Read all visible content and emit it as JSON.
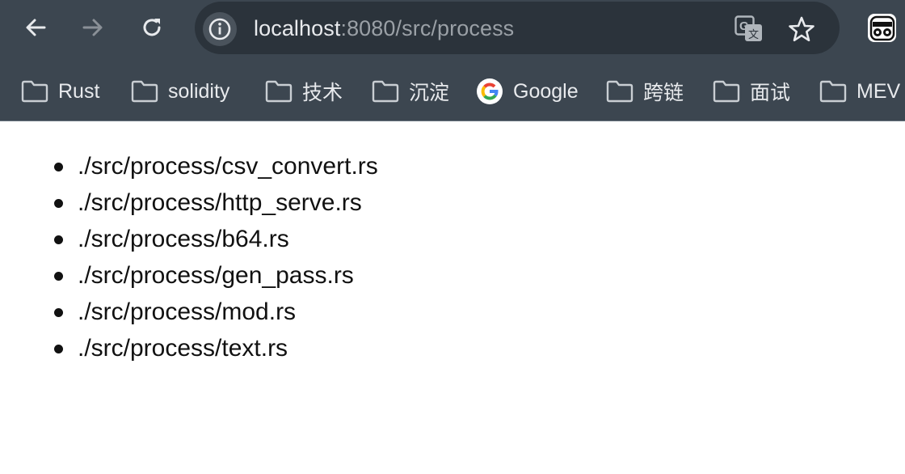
{
  "browser": {
    "nav": {
      "back_icon": "arrow-left-icon",
      "forward_icon": "arrow-right-icon",
      "reload_icon": "reload-icon"
    },
    "omnibox": {
      "site_info_icon": "info-icon",
      "url_host": "localhost",
      "url_rest": ":8080/src/process",
      "translate_icon": "translate-icon",
      "bookmark_icon": "star-icon"
    },
    "profile_icon": "profile-avatar-icon",
    "bookmarks": [
      {
        "label": "Rust",
        "icon": "folder-icon"
      },
      {
        "label": "solidity",
        "icon": "folder-icon"
      },
      {
        "label": "技术",
        "icon": "folder-icon"
      },
      {
        "label": "沉淀",
        "icon": "folder-icon"
      },
      {
        "label": "Google",
        "icon": "google-icon"
      },
      {
        "label": "跨链",
        "icon": "folder-icon"
      },
      {
        "label": "面试",
        "icon": "folder-icon"
      },
      {
        "label": "MEV",
        "icon": "folder-icon"
      }
    ]
  },
  "page": {
    "files": [
      "./src/process/csv_convert.rs",
      "./src/process/http_serve.rs",
      "./src/process/b64.rs",
      "./src/process/gen_pass.rs",
      "./src/process/mod.rs",
      "./src/process/text.rs"
    ]
  },
  "colors": {
    "chrome": "#3c4650",
    "omnibox": "#2b333b",
    "text_light": "#e8eaed",
    "text_dim": "#9aa0a6",
    "page_bg": "#ffffff",
    "page_text": "#111111"
  }
}
